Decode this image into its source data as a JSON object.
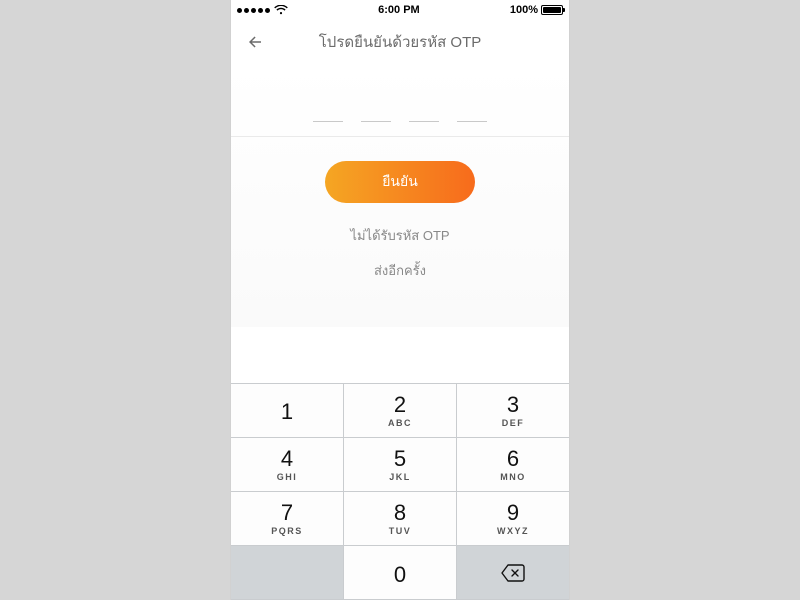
{
  "status": {
    "time": "6:00 PM",
    "battery_pct": "100%"
  },
  "header": {
    "title": "โปรดยืนยันด้วยรหัส OTP"
  },
  "otp": {
    "slots": [
      "",
      "",
      "",
      ""
    ]
  },
  "actions": {
    "confirm_label": "ยืนยัน",
    "not_received_label": "ไม่ได้รับรหัส OTP",
    "resend_label": "ส่งอีกครั้ง"
  },
  "keypad": {
    "keys": [
      {
        "num": "1",
        "letters": ""
      },
      {
        "num": "2",
        "letters": "ABC"
      },
      {
        "num": "3",
        "letters": "DEF"
      },
      {
        "num": "4",
        "letters": "GHI"
      },
      {
        "num": "5",
        "letters": "JKL"
      },
      {
        "num": "6",
        "letters": "MNO"
      },
      {
        "num": "7",
        "letters": "PQRS"
      },
      {
        "num": "8",
        "letters": "TUV"
      },
      {
        "num": "9",
        "letters": "WXYZ"
      },
      {
        "num": "0",
        "letters": ""
      }
    ]
  }
}
